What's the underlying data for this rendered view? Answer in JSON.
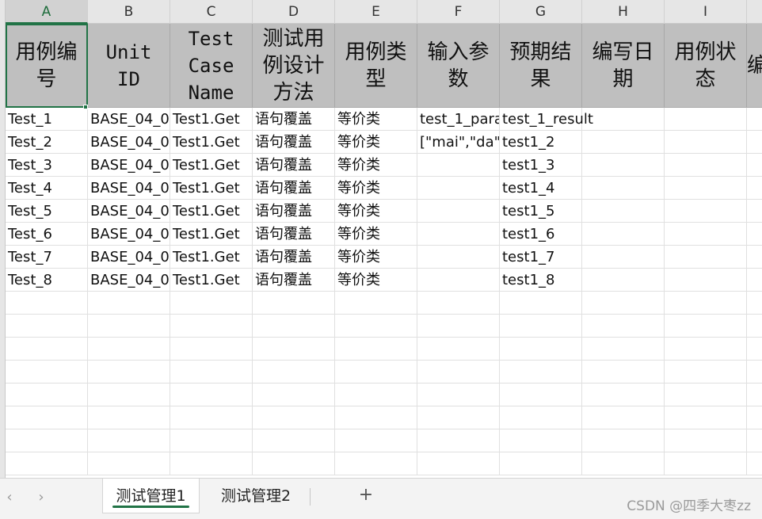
{
  "columns": [
    "A",
    "B",
    "C",
    "D",
    "E",
    "F",
    "G",
    "H",
    "I"
  ],
  "active_column": "A",
  "header_row": {
    "A": "用例编\n号",
    "B": "Unit\nID",
    "C": "Test\nCase\nName",
    "D": "测试用\n例设计\n方法",
    "E": "用例类\n型",
    "F": "输入参\n数",
    "G": "预期结\n果",
    "H": "编写日\n期",
    "I": "用例状\n态",
    "J_partial": "编"
  },
  "rows": [
    {
      "A": "Test_1",
      "B": "BASE_04_0",
      "C": "Test1.Get",
      "D": "语句覆盖",
      "E": "等价类",
      "F": "test_1_para",
      "G": "test_1_result",
      "H": "",
      "I": ""
    },
    {
      "A": "Test_2",
      "B": "BASE_04_0",
      "C": "Test1.Get",
      "D": "语句覆盖",
      "E": "等价类",
      "F": "[\"mai\",\"da\"",
      "G": "test1_2",
      "H": "",
      "I": ""
    },
    {
      "A": "Test_3",
      "B": "BASE_04_0",
      "C": "Test1.Get",
      "D": "语句覆盖",
      "E": "等价类",
      "F": "",
      "G": "test1_3",
      "H": "",
      "I": ""
    },
    {
      "A": "Test_4",
      "B": "BASE_04_0",
      "C": "Test1.Get",
      "D": "语句覆盖",
      "E": "等价类",
      "F": "",
      "G": "test1_4",
      "H": "",
      "I": ""
    },
    {
      "A": "Test_5",
      "B": "BASE_04_0",
      "C": "Test1.Get",
      "D": "语句覆盖",
      "E": "等价类",
      "F": "",
      "G": "test1_5",
      "H": "",
      "I": ""
    },
    {
      "A": "Test_6",
      "B": "BASE_04_0",
      "C": "Test1.Get",
      "D": "语句覆盖",
      "E": "等价类",
      "F": "",
      "G": "test1_6",
      "H": "",
      "I": ""
    },
    {
      "A": "Test_7",
      "B": "BASE_04_0",
      "C": "Test1.Get",
      "D": "语句覆盖",
      "E": "等价类",
      "F": "",
      "G": "test1_7",
      "H": "",
      "I": ""
    },
    {
      "A": "Test_8",
      "B": "BASE_04_0",
      "C": "Test1.Get",
      "D": "语句覆盖",
      "E": "等价类",
      "F": "",
      "G": "test1_8",
      "H": "",
      "I": ""
    }
  ],
  "empty_row_count": 8,
  "tabbar": {
    "prev_icon": "chevron-left-icon",
    "next_icon": "chevron-right-icon",
    "tabs": [
      "测试管理1",
      "测试管理2"
    ],
    "active_tab": 0,
    "add_label": "+",
    "watermark": "CSDN @四季大枣zz"
  },
  "colors": {
    "header_fill": "#bfbfbf",
    "accent": "#217346",
    "colhdr_fill": "#e6e6e6"
  }
}
